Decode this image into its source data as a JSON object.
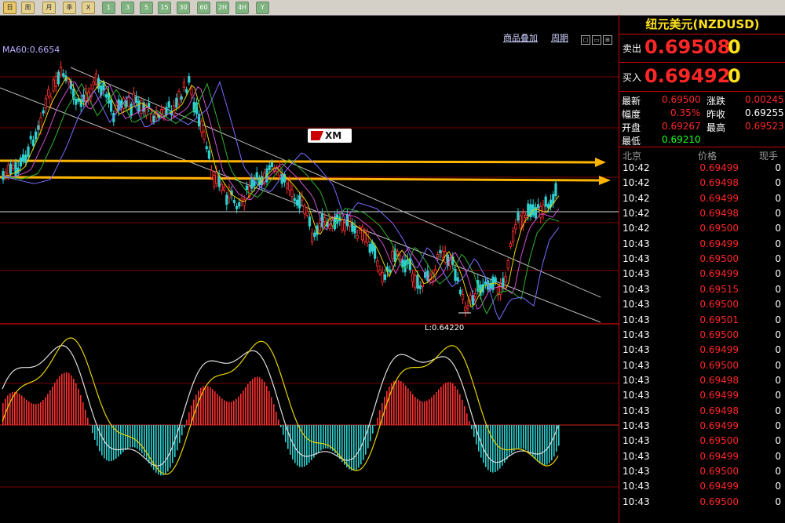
{
  "toolbar": {
    "buttons": [
      "日",
      "周",
      "月",
      "季",
      "X",
      "1",
      "3",
      "5",
      "15",
      "30",
      "60",
      "2H",
      "4H",
      "Y"
    ]
  },
  "chart": {
    "links": {
      "overlay": "商品叠加",
      "period": "周期"
    },
    "ma_label": "MA60:0.6654",
    "low_label": "L:0.64220",
    "logo_text": "XM"
  },
  "side": {
    "title": "纽元美元(NZDUSD)",
    "sell": {
      "label": "卖出",
      "price": "0.69508",
      "volume": "0"
    },
    "buy": {
      "label": "买入",
      "price": "0.69492",
      "volume": "0"
    },
    "stats": {
      "latest_label": "最新",
      "latest": "0.69500",
      "change_label": "涨跌",
      "change": "0.00245",
      "range_label": "幅度",
      "range": "0.35%",
      "prev_label": "昨收",
      "prev": "0.69255",
      "open_label": "开盘",
      "open": "0.69267",
      "high_label": "最高",
      "high": "0.69523",
      "low_label": "最低",
      "low": "0.69210"
    },
    "ticks_header": {
      "time": "北京",
      "price": "价格",
      "volume": "现手"
    },
    "ticks": [
      {
        "time": "10:42",
        "price": "0.69499",
        "vol": "0"
      },
      {
        "time": "10:42",
        "price": "0.69498",
        "vol": "0"
      },
      {
        "time": "10:42",
        "price": "0.69499",
        "vol": "0"
      },
      {
        "time": "10:42",
        "price": "0.69498",
        "vol": "0"
      },
      {
        "time": "10:42",
        "price": "0.69500",
        "vol": "0"
      },
      {
        "time": "10:43",
        "price": "0.69499",
        "vol": "0"
      },
      {
        "time": "10:43",
        "price": "0.69500",
        "vol": "0"
      },
      {
        "time": "10:43",
        "price": "0.69499",
        "vol": "0"
      },
      {
        "time": "10:43",
        "price": "0.69515",
        "vol": "0"
      },
      {
        "time": "10:43",
        "price": "0.69500",
        "vol": "0"
      },
      {
        "time": "10:43",
        "price": "0.69501",
        "vol": "0"
      },
      {
        "time": "10:43",
        "price": "0.69500",
        "vol": "0"
      },
      {
        "time": "10:43",
        "price": "0.69499",
        "vol": "0"
      },
      {
        "time": "10:43",
        "price": "0.69500",
        "vol": "0"
      },
      {
        "time": "10:43",
        "price": "0.69498",
        "vol": "0"
      },
      {
        "time": "10:43",
        "price": "0.69499",
        "vol": "0"
      },
      {
        "time": "10:43",
        "price": "0.69498",
        "vol": "0"
      },
      {
        "time": "10:43",
        "price": "0.69499",
        "vol": "0"
      },
      {
        "time": "10:43",
        "price": "0.69500",
        "vol": "0"
      },
      {
        "time": "10:43",
        "price": "0.69499",
        "vol": "0"
      },
      {
        "time": "10:43",
        "price": "0.69500",
        "vol": "0"
      },
      {
        "time": "10:43",
        "price": "0.69499",
        "vol": "0"
      },
      {
        "time": "10:43",
        "price": "0.69500",
        "vol": "0"
      }
    ]
  },
  "colors": {
    "up": "#ff3030",
    "down": "#2fd0d0",
    "arrow": "#ffb400",
    "accent": "#ffe21c"
  }
}
